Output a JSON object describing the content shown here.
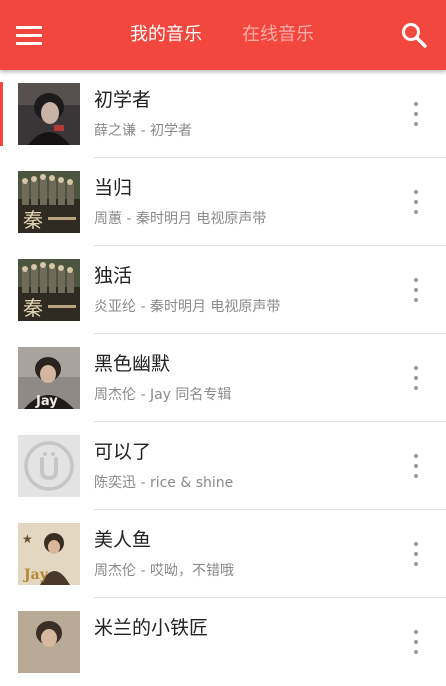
{
  "header": {
    "menu_icon": "menu-icon",
    "tabs": [
      {
        "label": "我的音乐",
        "active": true
      },
      {
        "label": "在线音乐",
        "active": false
      }
    ],
    "search_icon": "search-icon",
    "accent_color": "#f2473f"
  },
  "songs": [
    {
      "title": "初学者",
      "subtitle": "薛之谦 - 初学者",
      "cover": "person-portrait",
      "playing": true
    },
    {
      "title": "当归",
      "subtitle": "周蕙 - 秦时明月 电视原声带",
      "cover": "drama-poster"
    },
    {
      "title": "独活",
      "subtitle": "炎亚纶 - 秦时明月 电视原声带",
      "cover": "drama-poster"
    },
    {
      "title": "黑色幽默",
      "subtitle": "周杰伦 - Jay 同名专辑",
      "cover": "jay-album"
    },
    {
      "title": "可以了",
      "subtitle": "陈奕迅 - rice & shine",
      "cover": "placeholder-logo"
    },
    {
      "title": "美人鱼",
      "subtitle": "周杰伦 - 哎呦，不错哦",
      "cover": "jay-album-2"
    },
    {
      "title": "米兰的小铁匠",
      "subtitle": "",
      "cover": "person-portrait-2"
    }
  ],
  "cover_art_labels": {
    "drama": "秦",
    "jay": "Jay"
  }
}
